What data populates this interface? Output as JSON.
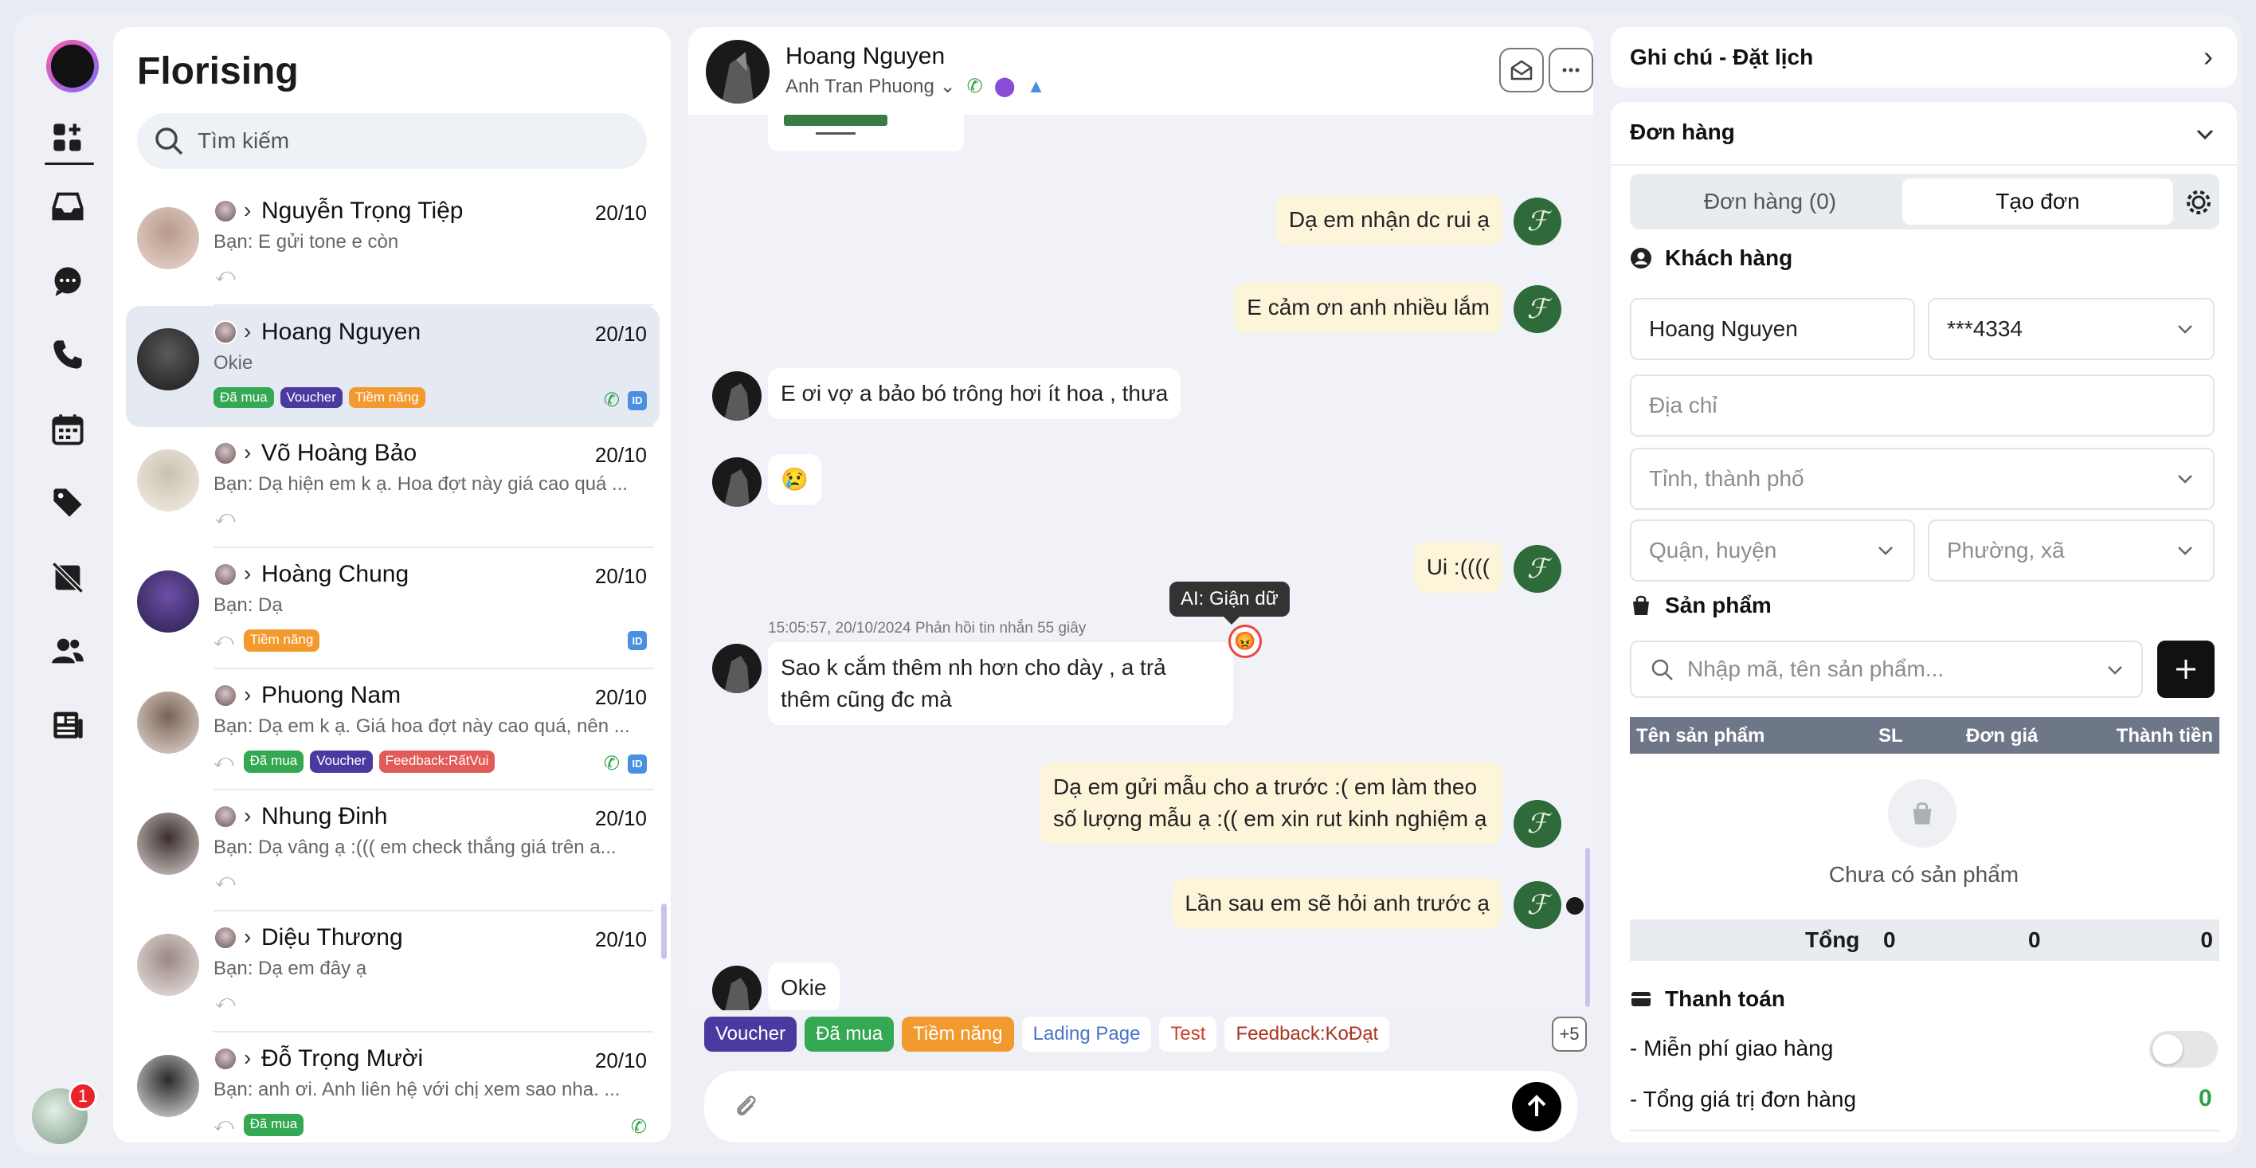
{
  "app": {
    "brand": "Florising",
    "notification_count": "1"
  },
  "search": {
    "placeholder": "Tìm kiếm"
  },
  "conversations": [
    {
      "name": "Nguyễn Trọng Tiệp",
      "date": "20/10",
      "preview": "Bạn: E gửi tone e còn",
      "tags": [],
      "active": false
    },
    {
      "name": "Hoang Nguyen",
      "date": "20/10",
      "preview": "Okie",
      "tags": [
        "Đã mua",
        "Voucher",
        "Tiềm năng"
      ],
      "active": true
    },
    {
      "name": "Võ Hoàng Bảo",
      "date": "20/10",
      "preview": "Bạn: Dạ hiện em k ạ. Hoa đợt này giá cao quá ...",
      "tags": [],
      "active": false
    },
    {
      "name": "Hoàng Chung",
      "date": "20/10",
      "preview": "Bạn: Dạ",
      "tags": [
        "Tiềm năng"
      ],
      "active": false
    },
    {
      "name": "Phuong Nam",
      "date": "20/10",
      "preview": "Bạn: Dạ em k ạ. Giá hoa đợt này cao quá, nên ...",
      "tags": [
        "Đã mua",
        "Voucher",
        "Feedback:RấtVui"
      ],
      "active": false
    },
    {
      "name": "Nhung Đinh",
      "date": "20/10",
      "preview": "Bạn: Dạ vâng ạ :((( em check thẳng giá trên a...",
      "tags": [],
      "active": false
    },
    {
      "name": "Diệu Thương",
      "date": "20/10",
      "preview": "Bạn: Dạ em đây ạ",
      "tags": [],
      "active": false
    },
    {
      "name": "Đỗ Trọng Mười",
      "date": "20/10",
      "preview": "Bạn: anh ơi. Anh liên hệ với chị xem sao nha. ...",
      "tags": [
        "Đã mua"
      ],
      "active": false
    }
  ],
  "chat": {
    "contact_name": "Hoang Nguyen",
    "assignee": "Anh Tran Phuong",
    "messages": [
      {
        "dir": "out",
        "text": "Dạ em nhận dc rui ạ"
      },
      {
        "dir": "out",
        "text": "E cảm ơn anh nhiều lắm"
      },
      {
        "dir": "in",
        "text": "E ơi vợ a bảo bó trông hơi ít hoa , thưa"
      },
      {
        "dir": "in",
        "text": "😢"
      },
      {
        "dir": "out",
        "text": "Ui :(((("
      },
      {
        "dir": "in",
        "text": "Sao k cắm thêm nh hơn cho dày , a trả thêm cũng đc mà"
      },
      {
        "dir": "out",
        "text": "Dạ em gửi mẫu cho a trước :( em làm theo số lượng mẫu ạ :(( em xin rut kinh nghiệm ạ"
      },
      {
        "dir": "out",
        "text": "Lần sau em sẽ hỏi anh trước ạ"
      },
      {
        "dir": "in",
        "text": "Okie"
      }
    ],
    "meta": "15:05:57, 20/10/2024  Phản hồi tin nhắn 55 giây",
    "ai_tooltip": "AI: Giận dữ",
    "quick_tags": [
      "Voucher",
      "Đã mua",
      "Tiềm năng",
      "Lading Page",
      "Test",
      "Feedback:KoĐạt"
    ],
    "more_tags": "+5"
  },
  "panel": {
    "notes_title": "Ghi chú - Đặt lịch",
    "orders_title": "Đơn hàng",
    "tab_orders": "Đơn hàng (0)",
    "tab_create": "Tạo đơn",
    "customer_title": "Khách hàng",
    "customer_name": "Hoang Nguyen",
    "customer_phone": "***4334",
    "address_ph": "Địa chỉ",
    "city_ph": "Tỉnh, thành phố",
    "district_ph": "Quận, huyện",
    "ward_ph": "Phường, xã",
    "products_title": "Sản phẩm",
    "product_search_ph": "Nhập mã, tên sản phẩm...",
    "col_name": "Tên sản phẩm",
    "col_qty": "SL",
    "col_price": "Đơn giá",
    "col_total": "Thành tiền",
    "empty": "Chưa có sản phẩm",
    "total_label": "Tổng",
    "total_qty": "0",
    "total_price": "0",
    "total_sum": "0",
    "payment_title": "Thanh toán",
    "free_ship": "- Miễn phí giao hàng",
    "order_value": "- Tổng giá trị đơn hàng",
    "order_value_num": "0"
  }
}
